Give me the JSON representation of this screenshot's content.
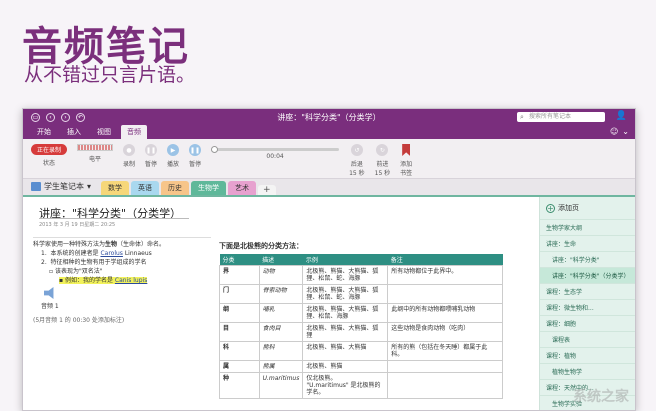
{
  "promo": {
    "title": "音频笔记",
    "subtitle": "从不错过只言片语。"
  },
  "window": {
    "title": "讲座：\"科学分类\"（分类学）",
    "search_placeholder": "搜索所有笔记本"
  },
  "ribbon_tabs": [
    "开始",
    "插入",
    "视图",
    "音频"
  ],
  "ribbon": {
    "rec_badge": "正在录制",
    "status_label": "状态",
    "level_label": "电平",
    "record_label": "录制",
    "pause_label": "暂停",
    "play_label": "播放",
    "stop_label": "暂停",
    "time": "00:04",
    "rewind_label": "后退\n15 秒",
    "forward_label": "前进\n15 秒",
    "bookmark_label": "添加\n书签"
  },
  "notebook": {
    "name": "学生笔记本",
    "sections": [
      {
        "label": "数学",
        "color": "#f6d77a"
      },
      {
        "label": "英语",
        "color": "#a9d8ef"
      },
      {
        "label": "历史",
        "color": "#f7c58a"
      },
      {
        "label": "生物学",
        "color": "#5fb89a",
        "active": true
      },
      {
        "label": "艺术",
        "color": "#e7a1cf"
      }
    ],
    "add_section": "+"
  },
  "page": {
    "title": "讲座：\"科学分类\"（分类学）",
    "date": "2013 年 3 月 19 日星期二    20:25"
  },
  "note_lines": [
    {
      "level": 0,
      "text": "科学家使用一种特殊方法为生物（生命体）命名。"
    },
    {
      "level": 1,
      "text": "1.  本系统的创建者是 Carolus Linnaeus"
    },
    {
      "level": 1,
      "text": "2.  特征相种的生物有用于学组成的学名"
    },
    {
      "level": 2,
      "text": "▫ 该表现为\"双名法\""
    },
    {
      "level": 3,
      "text": "▪ 例如：我的学名是 Canis lupis",
      "highlight": true
    }
  ],
  "audio": {
    "label": "音频 1",
    "note": "(5月音频 1 的 00:30 处添加标注)"
  },
  "table": {
    "caption": "下面是北极熊的分类方法：",
    "headers": [
      "分类",
      "描述",
      "示例",
      "备注"
    ],
    "rows": [
      [
        "界",
        "动物",
        "北极熊、熊猫、大熊猫、狐狸、松鼠、蛇、海豚",
        "所有动物都位于此界中。"
      ],
      [
        "门",
        "脊索动物",
        "北极熊、熊猫、大熊猫、狐狸、松鼠、蛇、海豚",
        ""
      ],
      [
        "纲",
        "哺乳",
        "北极熊、熊猫、大熊猫、狐狸、松鼠、海豚",
        "此纲中的所有动物都喂哺乳动物"
      ],
      [
        "目",
        "食肉目",
        "北极熊、熊猫、大熊猫、狐狸",
        "这些动物是食肉动物（吃肉）"
      ],
      [
        "科",
        "熊科",
        "北极熊、熊猫、大熊猫",
        "所有的熊（包括在冬天睡）都属于此科。"
      ],
      [
        "属",
        "熊属",
        "北极熊、熊猫",
        ""
      ],
      [
        "种",
        "U.maritimus",
        "仅北极熊。\n\"U.maritimus\" 是北极熊的学名。",
        ""
      ]
    ]
  },
  "pages_panel": {
    "add_page": "添加页",
    "pages": [
      {
        "label": "生物学家大纲",
        "indent": 0
      },
      {
        "label": "讲座：生命",
        "indent": 0
      },
      {
        "label": "讲座：\"科学分类\"",
        "indent": 1
      },
      {
        "label": "讲座：\"科学分类\"（分类学）",
        "indent": 1,
        "selected": true
      },
      {
        "label": "课程：生态学",
        "indent": 0
      },
      {
        "label": "课程：微生物和...",
        "indent": 0
      },
      {
        "label": "课程：细胞",
        "indent": 0
      },
      {
        "label": "课程表",
        "indent": 1
      },
      {
        "label": "课程：植物",
        "indent": 0
      },
      {
        "label": "植物生物学",
        "indent": 1
      },
      {
        "label": "课程：天然中的...",
        "indent": 0
      },
      {
        "label": "生物学实验",
        "indent": 1
      },
      {
        "label": "实验必需材料",
        "indent": 1
      }
    ]
  },
  "watermark": "系统之家"
}
